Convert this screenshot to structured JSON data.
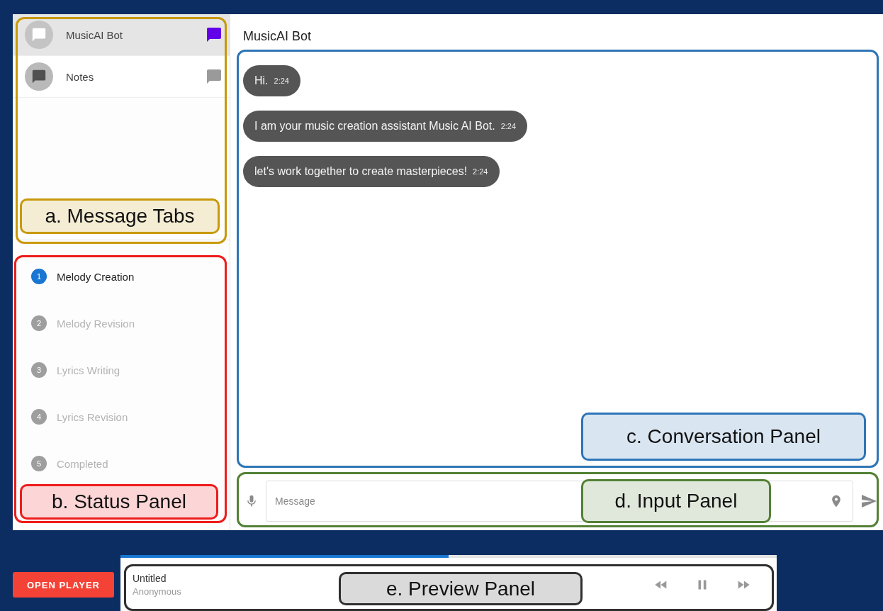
{
  "tabs": [
    {
      "name": "MusicAI Bot",
      "selected": true
    },
    {
      "name": "Notes",
      "selected": false
    }
  ],
  "steps": [
    {
      "number": "1",
      "label": "Melody Creation",
      "active": true
    },
    {
      "number": "2",
      "label": "Melody Revision",
      "active": false
    },
    {
      "number": "3",
      "label": "Lyrics Writing",
      "active": false
    },
    {
      "number": "4",
      "label": "Lyrics Revision",
      "active": false
    },
    {
      "number": "5",
      "label": "Completed",
      "active": false
    }
  ],
  "chat": {
    "title": "MusicAI Bot",
    "messages": [
      {
        "text": "Hi.",
        "time": "2:24"
      },
      {
        "text": "I am your music creation assistant Music AI Bot.",
        "time": "2:24"
      },
      {
        "text": "let's work together to create masterpieces!",
        "time": "2:24"
      }
    ]
  },
  "input": {
    "placeholder": "Message"
  },
  "player": {
    "button": "OPEN PLAYER",
    "title": "Untitled",
    "artist": "Anonymous",
    "level": 0.5
  },
  "annotations": [
    {
      "label": "a. Message Tabs",
      "color": "#c8990a"
    },
    {
      "label": "b. Status Panel",
      "color": "#ee1c1c"
    },
    {
      "label": "c. Conversation Panel",
      "color": "#2e75b6"
    },
    {
      "label": "d. Input Panel",
      "color": "#538135"
    },
    {
      "label": "e. Preview Panel",
      "color": "#303030"
    }
  ]
}
